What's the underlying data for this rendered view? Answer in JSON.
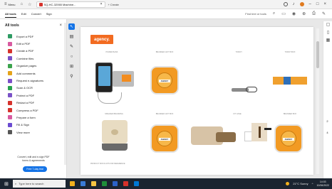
{
  "titlebar": {
    "menu_label": "Menu",
    "home_icon": "home-icon",
    "star_icon": "star-icon",
    "doc_tab_title": "SQ-HC-32065 Machine...",
    "create_label": "Create",
    "help_icon": "help-icon",
    "bell_icon": "bell-icon",
    "minimize_icon": "minimize-icon",
    "maximize_icon": "maximize-icon",
    "close_icon": "close-icon"
  },
  "menubar": {
    "items": [
      "All tools",
      "Edit",
      "Convert",
      "Sign"
    ],
    "active_item": "All tools",
    "find_text_label": "Find text or tools"
  },
  "tools_panel": {
    "title": "All tools",
    "tools": [
      {
        "label": "Export a PDF",
        "color": "#2e9b63"
      },
      {
        "label": "Edit a PDF",
        "color": "#d85aa0"
      },
      {
        "label": "Create a PDF",
        "color": "#d6322c"
      },
      {
        "label": "Combine files",
        "color": "#7a52c7"
      },
      {
        "label": "Organize pages",
        "color": "#3ba34c"
      },
      {
        "label": "Add comments",
        "color": "#e5a31a"
      },
      {
        "label": "Request e-signatures",
        "color": "#7b4fc9"
      },
      {
        "label": "Scan & OCR",
        "color": "#27a24e"
      },
      {
        "label": "Protect a PDF",
        "color": "#7a52c7"
      },
      {
        "label": "Redact a PDF",
        "color": "#d6322c"
      },
      {
        "label": "Compress a PDF",
        "color": "#d6322c"
      },
      {
        "label": "Prepare a form",
        "color": "#d85aa0"
      },
      {
        "label": "Fill & Sign",
        "color": "#6b4bd1"
      },
      {
        "label": "View more",
        "color": "#555555"
      }
    ],
    "promo_text_1": "Convert, edit and e-sign PDF",
    "promo_text_2": "forms & agreements",
    "trial_button": "Free 7-day trial"
  },
  "document": {
    "logo_text": "agency.",
    "captions_row1": [
      "POWER BANK",
      "BRANDED GIFT BOX",
      "TORCH",
      "TORCH BOX"
    ],
    "captions_row2": [
      "SPEAKER BRANDING",
      "BRANDED GIFT BOX",
      "KIT CASE",
      "BRANDED BOX"
    ],
    "badge_text": "AGENCY",
    "footnote": "PRODUCT MOCK-UPS FOR REFERENCE"
  },
  "right_rail": {
    "page_number": "2",
    "page_total": "4"
  },
  "taskbar": {
    "search_placeholder": "Type here to search",
    "weather": "21°C  Sunny",
    "time": "14:03",
    "date": "10/06/2022"
  }
}
